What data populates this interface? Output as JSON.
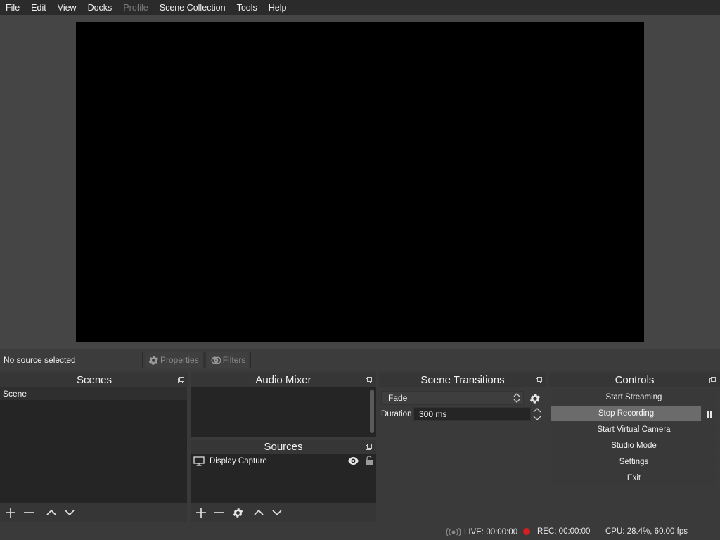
{
  "menu": [
    "File",
    "Edit",
    "View",
    "Docks",
    "Profile",
    "Scene Collection",
    "Tools",
    "Help"
  ],
  "context": {
    "source_label": "No source selected",
    "properties_label": "Properties",
    "filters_label": "Filters"
  },
  "docks": {
    "scenes": {
      "title": "Scenes",
      "items": [
        "Scene"
      ]
    },
    "audio_mixer": {
      "title": "Audio Mixer"
    },
    "sources": {
      "title": "Sources",
      "items": [
        "Display Capture"
      ]
    },
    "transitions": {
      "title": "Scene Transitions",
      "selected": "Fade",
      "duration_label": "Duration",
      "duration_value": "300 ms"
    },
    "controls": {
      "title": "Controls",
      "buttons": {
        "start_streaming": "Start Streaming",
        "stop_recording": "Stop Recording",
        "start_virtual_camera": "Start Virtual Camera",
        "studio_mode": "Studio Mode",
        "settings": "Settings",
        "exit": "Exit"
      }
    }
  },
  "status": {
    "live": "LIVE: 00:00:00",
    "rec": "REC: 00:00:00",
    "cpu": "CPU: 28.4%, 60.00 fps"
  },
  "colors": {
    "rec_indicator": "#d42020",
    "canvas": "#000000"
  }
}
